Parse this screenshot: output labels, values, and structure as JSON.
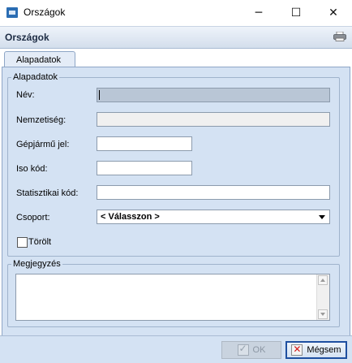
{
  "window": {
    "title": "Országok",
    "controls": {
      "minimize": "─",
      "maximize": "☐",
      "close": "✕"
    }
  },
  "header": {
    "title": "Országok",
    "print_icon": "printer-icon"
  },
  "tabs": [
    {
      "label": "Alapadatok",
      "selected": true
    }
  ],
  "basic_group": {
    "legend": "Alapadatok",
    "fields": {
      "name": {
        "label": "Név:",
        "value": ""
      },
      "nationality": {
        "label": "Nemzetiség:",
        "value": ""
      },
      "vehicle_code": {
        "label": "Gépjármű jel:",
        "value": ""
      },
      "iso_code": {
        "label": "Iso kód:",
        "value": ""
      },
      "stat_code": {
        "label": "Statisztikai kód:",
        "value": ""
      },
      "group": {
        "label": "Csoport:",
        "selected": "< Válasszon >"
      }
    },
    "deleted": {
      "label": "Törölt",
      "checked": false
    }
  },
  "notes_group": {
    "legend": "Megjegyzés",
    "value": ""
  },
  "footer": {
    "ok_label": "OK",
    "cancel_label": "Mégsem"
  },
  "colors": {
    "panel_bg": "#d4e2f3",
    "accent_border": "#1e4fa0",
    "cancel_icon": "#d31616"
  }
}
